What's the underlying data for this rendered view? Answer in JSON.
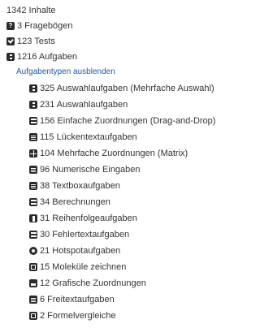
{
  "summary": {
    "total_label": "1342 Inhalte"
  },
  "categories": [
    {
      "label": "3 Fragebögen",
      "icon": "questionnaire-icon"
    },
    {
      "label": "123 Tests",
      "icon": "checkbox-icon"
    },
    {
      "label": "1216 Aufgaben",
      "icon": "task-icon"
    }
  ],
  "toggle": {
    "label": "Aufgabentypen ausblenden"
  },
  "task_types": [
    {
      "label": "325 Auswahlaufgaben (Mehrfache Auswahl)",
      "icon": "multiple-choice-icon"
    },
    {
      "label": "231 Auswahlaufgaben",
      "icon": "single-choice-icon"
    },
    {
      "label": "156 Einfache Zuordnungen (Drag-and-Drop)",
      "icon": "drag-drop-icon"
    },
    {
      "label": "115 Lückentextaufgaben",
      "icon": "cloze-icon"
    },
    {
      "label": "104 Mehrfache Zuordnungen (Matrix)",
      "icon": "matrix-icon"
    },
    {
      "label": "96 Numerische Eingaben",
      "icon": "numeric-input-icon"
    },
    {
      "label": "38 Textboxaufgaben",
      "icon": "textbox-icon"
    },
    {
      "label": "34 Berechnungen",
      "icon": "calculation-icon"
    },
    {
      "label": "31 Reihenfolgeaufgaben",
      "icon": "ordering-icon"
    },
    {
      "label": "30 Fehlertextaufgaben",
      "icon": "error-text-icon"
    },
    {
      "label": "21 Hotspotaufgaben",
      "icon": "hotspot-icon"
    },
    {
      "label": "15 Moleküle zeichnen",
      "icon": "molecule-icon"
    },
    {
      "label": "12 Grafische Zuordnungen",
      "icon": "graphic-matching-icon"
    },
    {
      "label": "6 Freitextaufgaben",
      "icon": "free-text-icon"
    },
    {
      "label": "2 Formelvergleiche",
      "icon": "formula-icon"
    }
  ],
  "colors": {
    "text": "#333333",
    "icon": "#2b2b2b",
    "link": "#1a5aa8"
  }
}
